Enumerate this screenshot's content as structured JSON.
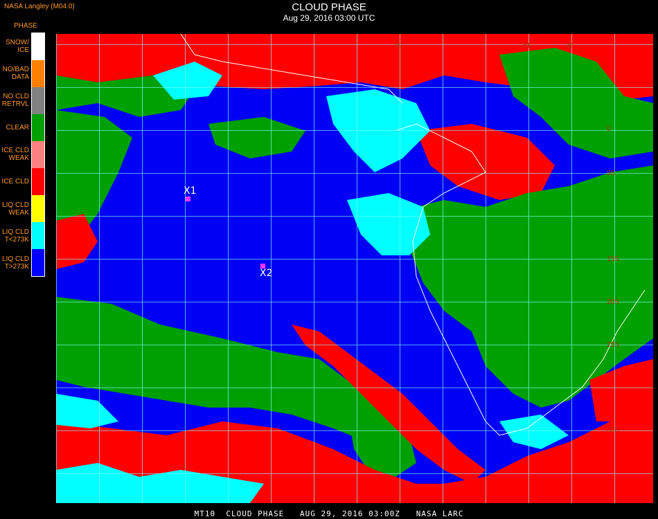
{
  "header": {
    "agency": "NASA Langley (M04.0)",
    "title": "CLOUD PHASE",
    "subtitle": "Aug 29, 2016 03:00 UTC"
  },
  "legend": {
    "title": "PHASE",
    "items": [
      {
        "label": "SNOW/\nICE",
        "color": "#ffffff"
      },
      {
        "label": "NO/BAD\nDATA",
        "color": "#ff7f00"
      },
      {
        "label": "NO CLD\nRETRVL",
        "color": "#808080"
      },
      {
        "label": "CLEAR",
        "color": "#00a000"
      },
      {
        "label": "ICE CLD\nWEAK",
        "color": "#ff8080"
      },
      {
        "label": "ICE CLD",
        "color": "#ff0000"
      },
      {
        "label": "LIQ CLD\nWEAK",
        "color": "#ffff00"
      },
      {
        "label": "LIQ CLD\nT<273K",
        "color": "#00ffff"
      },
      {
        "label": "LIQ CLD\nT>273K",
        "color": "#0000ff"
      }
    ]
  },
  "markers": [
    {
      "label": "X1"
    },
    {
      "label": "X2"
    }
  ],
  "map_labels": {
    "lon_top": [
      "0E",
      "25E",
      "30"
    ],
    "lat_right": [
      "0",
      "5S",
      "15S",
      "20S",
      "25S",
      "35S"
    ]
  },
  "footer": "MT10  CLOUD PHASE   AUG 29, 2016 03:00Z   NASA LARC",
  "colors": {
    "ice": "#ff0000",
    "liquid_warm": "#0000f4",
    "liquid_cold": "#00ffff",
    "clear": "#00a000",
    "grid": "#7fffff",
    "coast": "#ffffff"
  }
}
